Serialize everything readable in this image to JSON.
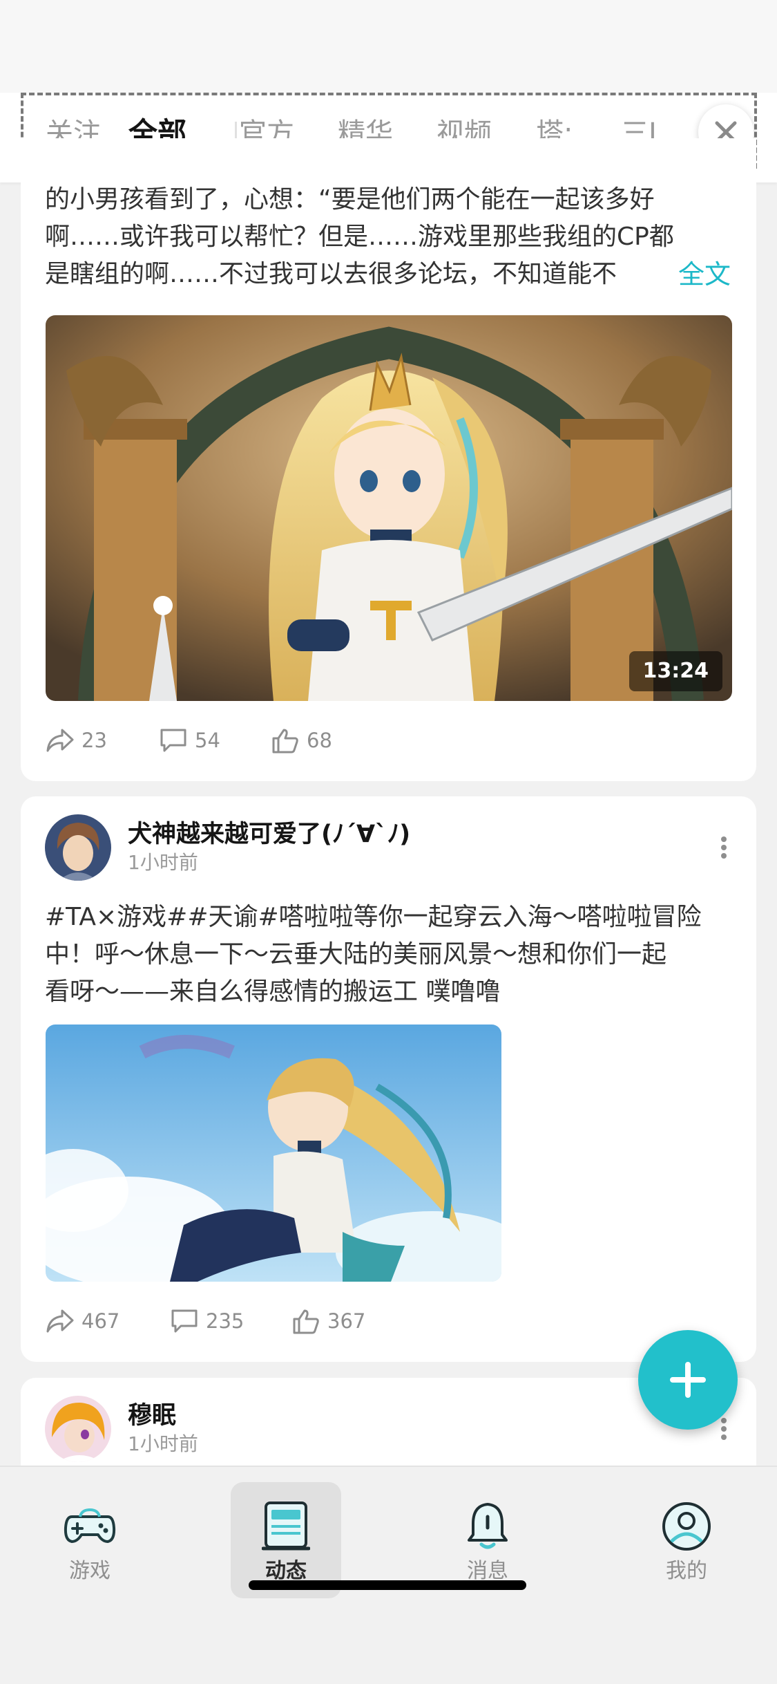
{
  "tabs": {
    "items": [
      {
        "label": "关注",
        "active": false
      },
      {
        "label": "全部",
        "active": true
      },
      {
        "label": "官方",
        "active": false
      },
      {
        "label": "精华",
        "active": false
      },
      {
        "label": "视频",
        "active": false
      },
      {
        "label": "塔:",
        "active": false
      },
      {
        "label": "三Ⅰ",
        "active": false
      }
    ],
    "accent_color": "#1cb8c8",
    "close_icon": "close-icon"
  },
  "posts": [
    {
      "text_lines": [
        "的小男孩看到了，心想：“要是他们两个能在一起该多好",
        "啊……或许我可以帮忙？但是……游戏里那些我组的CP都",
        "是瞎组的啊……不过我可以去很多论坛，不知道能不"
      ],
      "read_more": "全文",
      "video_duration": "13:24",
      "actions": {
        "share": "23",
        "comment": "54",
        "like": "68"
      }
    },
    {
      "author": "犬神越来越可爱了(ﾉ´∀`ﾉ)",
      "time": "1小时前",
      "text_lines": [
        "#TA×游戏##天谕#嗒啦啦等你一起穿云入海～嗒啦啦冒险",
        "中！呼～休息一下～云垂大陆的美丽风景～想和你们一起",
        "看呀～——来自么得感情的搬运工 噗噜噜"
      ],
      "actions": {
        "share": "467",
        "comment": "235",
        "like": "367"
      }
    },
    {
      "author": "穆眠",
      "time": "1小时前"
    }
  ],
  "fab": {
    "icon": "plus-icon",
    "color": "#22c0cb"
  },
  "bottom_nav": {
    "items": [
      {
        "label": "游戏",
        "icon": "gamepad-icon",
        "active": false
      },
      {
        "label": "动态",
        "icon": "feed-icon",
        "active": true
      },
      {
        "label": "消息",
        "icon": "bell-icon",
        "active": false
      },
      {
        "label": "我的",
        "icon": "profile-icon",
        "active": false
      }
    ]
  }
}
